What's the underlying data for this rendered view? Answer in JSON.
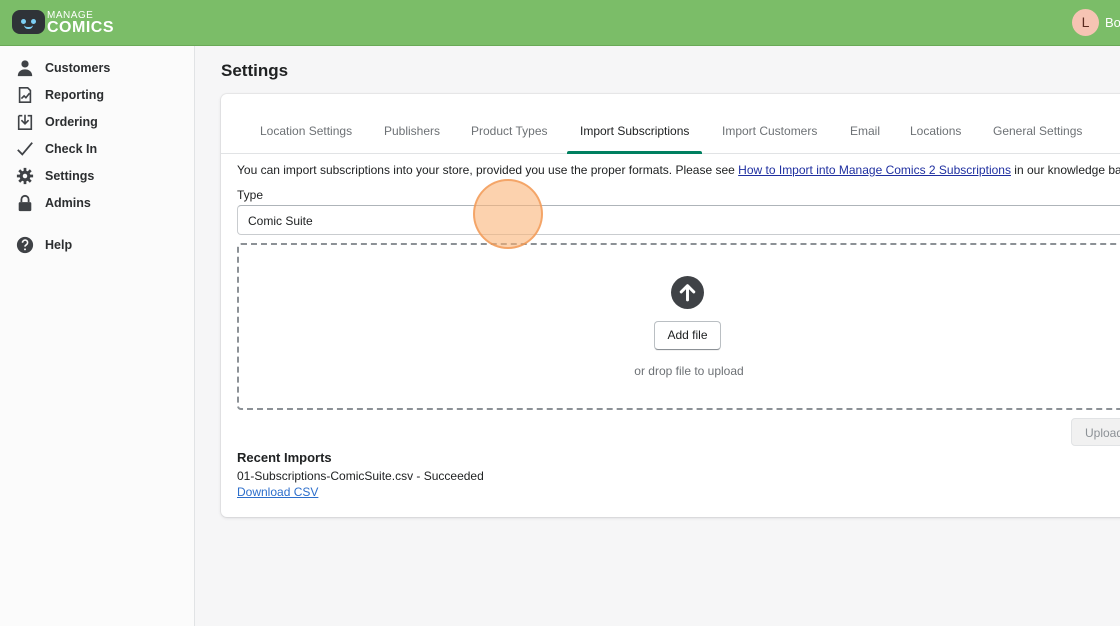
{
  "app": {
    "logo_top": "MANAGE",
    "logo_bottom": "COMICS",
    "user_initial": "L",
    "user_name": "Bo"
  },
  "sidebar": {
    "items": [
      {
        "label": "Customers",
        "icon": "person-icon"
      },
      {
        "label": "Reporting",
        "icon": "report-icon"
      },
      {
        "label": "Ordering",
        "icon": "download-tray-icon"
      },
      {
        "label": "Check In",
        "icon": "checkmark-icon"
      },
      {
        "label": "Settings",
        "icon": "gear-icon"
      },
      {
        "label": "Admins",
        "icon": "lock-icon"
      },
      {
        "label": "Help",
        "icon": "question-circle-icon"
      }
    ]
  },
  "main": {
    "title": "Settings",
    "tabs": [
      {
        "label": "Location Settings",
        "active": false
      },
      {
        "label": "Publishers",
        "active": false
      },
      {
        "label": "Product Types",
        "active": false
      },
      {
        "label": "Import Subscriptions",
        "active": true
      },
      {
        "label": "Import Customers",
        "active": false
      },
      {
        "label": "Email",
        "active": false
      },
      {
        "label": "Locations",
        "active": false
      },
      {
        "label": "General Settings",
        "active": false
      }
    ],
    "intro_before": "You can import subscriptions into your store, provided you use the proper formats. Please see ",
    "intro_link": "How to Import into Manage Comics 2 Subscriptions",
    "intro_after": " in our knowledge base",
    "type_label": "Type",
    "type_value": "Comic Suite",
    "dropzone": {
      "add_file_label": "Add file",
      "hint": "or drop file to upload",
      "icon": "upload-arrow-icon"
    },
    "upload_button_label": "Upload",
    "recent": {
      "title": "Recent Imports",
      "file_line": "01-Subscriptions-ComicSuite.csv - Succeeded",
      "download_label": "Download CSV"
    }
  },
  "colors": {
    "topbar": "#7bbd68",
    "active_tab_underline": "#008060",
    "link": "#2c6ecb"
  }
}
